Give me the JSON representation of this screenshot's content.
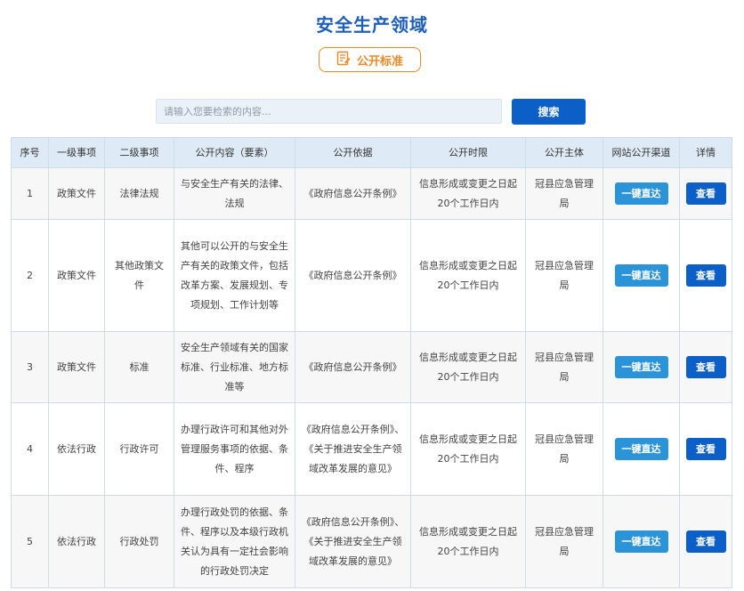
{
  "page": {
    "title": "安全生产领域",
    "standard_badge": "公开标准"
  },
  "search": {
    "placeholder": "请输入您要检索的内容...",
    "button_label": "搜索"
  },
  "table": {
    "headers": [
      "序号",
      "一级事项",
      "二级事项",
      "公开内容（要素）",
      "公开依据",
      "公开时限",
      "公开主体",
      "网站公开渠道",
      "详情"
    ],
    "rows": [
      {
        "no": "1",
        "level1": "政策文件",
        "level2": "法律法规",
        "content": "与安全生产有关的法律、法规",
        "basis": "《政府信息公开条例》",
        "time_limit": "信息形成或变更之日起20个工作日内",
        "subject": "冠县应急管理局",
        "channel_label": "一键直达",
        "detail_label": "查看"
      },
      {
        "no": "2",
        "level1": "政策文件",
        "level2": "其他政策文件",
        "content": "其他可以公开的与安全生产有关的政策文件，包括改革方案、发展规划、专项规划、工作计划等",
        "basis": "《政府信息公开条例》",
        "time_limit": "信息形成或变更之日起20个工作日内",
        "subject": "冠县应急管理局",
        "channel_label": "一键直达",
        "detail_label": "查看"
      },
      {
        "no": "3",
        "level1": "政策文件",
        "level2": "标准",
        "content": "安全生产领域有关的国家标准、行业标准、地方标准等",
        "basis": "《政府信息公开条例》",
        "time_limit": "信息形成或变更之日起20个工作日内",
        "subject": "冠县应急管理局",
        "channel_label": "一键直达",
        "detail_label": "查看"
      },
      {
        "no": "4",
        "level1": "依法行政",
        "level2": "行政许可",
        "content": "办理行政许可和其他对外管理服务事项的依据、条件、程序",
        "basis": "《政府信息公开条例》、《关于推进安全生产领域改革发展的意见》",
        "time_limit": "信息形成或变更之日起20个工作日内",
        "subject": "冠县应急管理局",
        "channel_label": "一键直达",
        "detail_label": "查看"
      },
      {
        "no": "5",
        "level1": "依法行政",
        "level2": "行政处罚",
        "content": "办理行政处罚的依据、条件、程序以及本级行政机关认为具有一定社会影响的行政处罚决定",
        "basis": "《政府信息公开条例》、《关于推进安全生产领域改革发展的意见》",
        "time_limit": "信息形成或变更之日起20个工作日内",
        "subject": "冠县应急管理局",
        "channel_label": "一键直达",
        "detail_label": "查看"
      }
    ]
  },
  "colors": {
    "title_blue": "#1f5fb8",
    "badge_orange": "#e98a2a",
    "primary_blue": "#0b5fc7",
    "channel_blue": "#2b93d8",
    "header_bg": "#deebf7"
  },
  "icons": {
    "badge_icon": "edit-document-icon"
  }
}
